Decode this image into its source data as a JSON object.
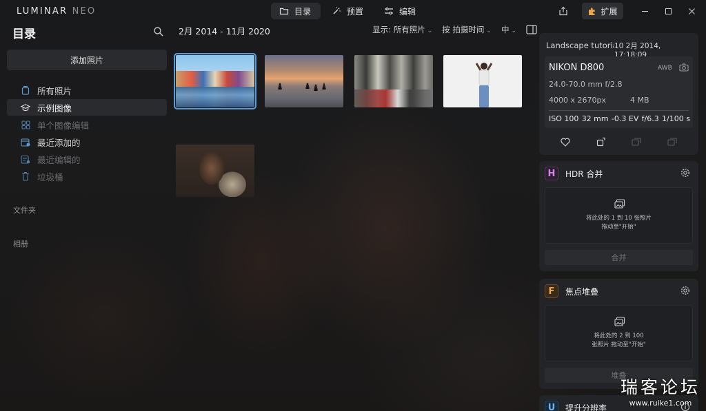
{
  "app": {
    "logo_main": "LUMINAR",
    "logo_neo": "NEO"
  },
  "modes": [
    {
      "label": "目录",
      "icon": "folder-icon",
      "active": true
    },
    {
      "label": "预置",
      "icon": "magic-wand-icon",
      "active": false
    },
    {
      "label": "编辑",
      "icon": "sliders-icon",
      "active": false
    }
  ],
  "titlebar": {
    "extensions_label": "扩展"
  },
  "sidebar": {
    "title": "目录",
    "add_photos": "添加照片",
    "items": [
      {
        "label": "所有照片",
        "icon": "photo-stack-icon",
        "state": "normal"
      },
      {
        "label": "示例图像",
        "icon": "graduation-cap-icon",
        "state": "active"
      },
      {
        "label": "单个图像编辑",
        "icon": "grid-icon",
        "state": "dim"
      },
      {
        "label": "最近添加的",
        "icon": "calendar-add-icon",
        "state": "normal"
      },
      {
        "label": "最近编辑的",
        "icon": "recent-edit-icon",
        "state": "dim"
      },
      {
        "label": "垃圾桶",
        "icon": "trash-icon",
        "state": "dim"
      }
    ],
    "folders_label": "文件夹",
    "albums_label": "相册"
  },
  "toolbar": {
    "date_range": "2月 2014 - 11月 2020",
    "show_label": "显示:",
    "show_value": "所有照片",
    "sort_value": "按 拍摄时间",
    "size_value": "中"
  },
  "thumbnails": [
    {
      "name": "colorful-harbor-houses",
      "selected": true
    },
    {
      "name": "beach-sunset",
      "selected": false
    },
    {
      "name": "city-street",
      "selected": false
    },
    {
      "name": "woman-white-background",
      "selected": false
    },
    {
      "name": "portrait-woman",
      "selected": false
    }
  ],
  "info": {
    "filename": "Landscape tutoria",
    "date": "10 2月 2014, 17:18:09",
    "camera": "NIKON D800",
    "wb": "AWB",
    "lens": "24.0-70.0 mm f/2.8",
    "resolution": "4000 x 2670px",
    "filesize": "4 MB",
    "iso": "ISO 100",
    "focal": "32 mm",
    "ev": "-0.3 EV",
    "aperture": "f/6.3",
    "shutter": "1/100 s"
  },
  "tools": {
    "hdr": {
      "title": "HDR 合并",
      "badge": "H",
      "badge_color": "#c86fd6",
      "drop_line1": "将此处的 1 到 10 张照片",
      "drop_line2": "拖动至\"开始\"",
      "button": "合并"
    },
    "focus": {
      "title": "焦点堆叠",
      "badge": "F",
      "badge_color": "#e49a4a",
      "drop_line1": "将此处的 2 到 100",
      "drop_line2": "张照片 拖动至\"开始\"",
      "button": "堆叠"
    },
    "upscale": {
      "title": "提升分辨率",
      "badge": "U",
      "badge_color": "#58a8e6"
    }
  },
  "watermark": {
    "line1": "瑞客论坛",
    "line2": "www.ruike1.com"
  }
}
